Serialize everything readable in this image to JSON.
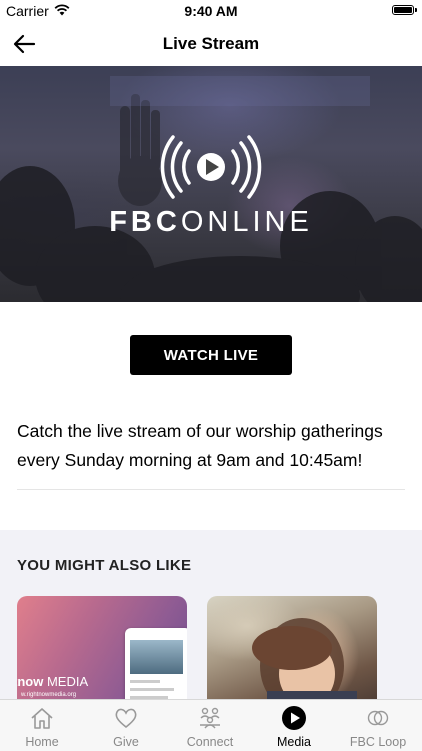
{
  "status_bar": {
    "carrier": "Carrier",
    "time": "9:40 AM"
  },
  "nav": {
    "title": "Live Stream",
    "back_icon": "arrow-left-icon"
  },
  "hero": {
    "logo_bold": "FBC",
    "logo_light": "ONLINE",
    "logo_icon": "broadcast-play-icon"
  },
  "main": {
    "watch_button": "WATCH LIVE",
    "description": "Catch the live stream of our worship gatherings every Sunday morning at 9am and 10:45am!"
  },
  "also_like": {
    "heading": "YOU MIGHT ALSO LIKE",
    "cards": [
      {
        "brand_bold": "tnow",
        "brand_light": " MEDIA",
        "url": "w.rightnowmedia.org"
      },
      {}
    ]
  },
  "tabs": [
    {
      "label": "Home",
      "icon": "home-icon",
      "active": false
    },
    {
      "label": "Give",
      "icon": "heart-icon",
      "active": false
    },
    {
      "label": "Connect",
      "icon": "people-icon",
      "active": false
    },
    {
      "label": "Media",
      "icon": "play-circle-icon",
      "active": true
    },
    {
      "label": "FBC Loop",
      "icon": "loop-circles-icon",
      "active": false
    }
  ]
}
